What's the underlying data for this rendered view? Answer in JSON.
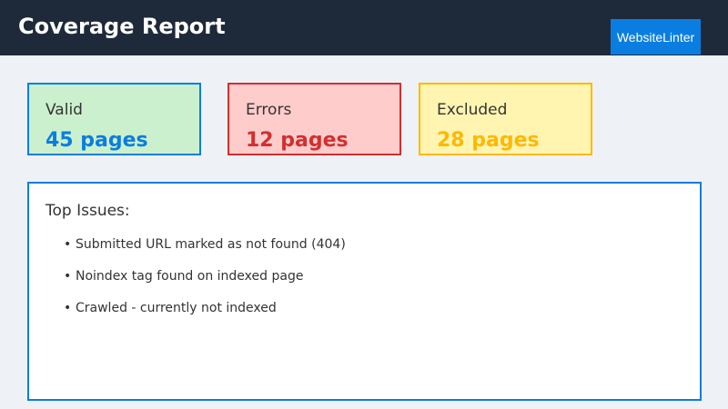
{
  "header": {
    "title": "Coverage Report",
    "brand_label": "WebsiteLinter"
  },
  "cards": [
    {
      "label": "Valid",
      "value": "45 pages",
      "bg_color": "#cbf0cd",
      "border_color": "#0a7ee0",
      "value_color": "#0a7ee0"
    },
    {
      "label": "Errors",
      "value": "12 pages",
      "bg_color": "#ffcccc",
      "border_color": "#d32f2f",
      "value_color": "#d32f2f"
    },
    {
      "label": "Excluded",
      "value": "28 pages",
      "bg_color": "#fff5b0",
      "border_color": "#ffb800",
      "value_color": "#ffb800"
    }
  ],
  "issues": {
    "title": "Top Issues:",
    "bullet": "•",
    "items": [
      "Submitted URL marked as not found (404)",
      "Noindex tag found on indexed page",
      "Crawled - currently not indexed"
    ]
  },
  "colors": {
    "header_bg": "#1e2a3a",
    "page_bg": "#eef2f7",
    "accent": "#0a7ee0"
  }
}
